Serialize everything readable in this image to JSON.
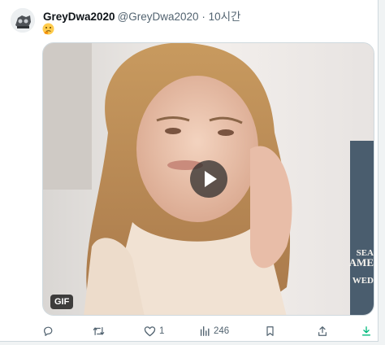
{
  "tweet": {
    "display_name": "GreyDwa2020",
    "handle": "@GreyDwa2020",
    "separator": " · ",
    "time": "10시간",
    "emoji_icon": "thinking-face-emoji"
  },
  "media": {
    "badge": "GIF",
    "overlay_text": [
      "SEA",
      "AME",
      "WED"
    ]
  },
  "actions": {
    "reply_count": "",
    "retweet_count": "",
    "like_count": "1",
    "views_count": "246"
  },
  "colors": {
    "secondary_text": "#536471",
    "primary_text": "#0f1419",
    "accent_green": "#00ba7c"
  }
}
